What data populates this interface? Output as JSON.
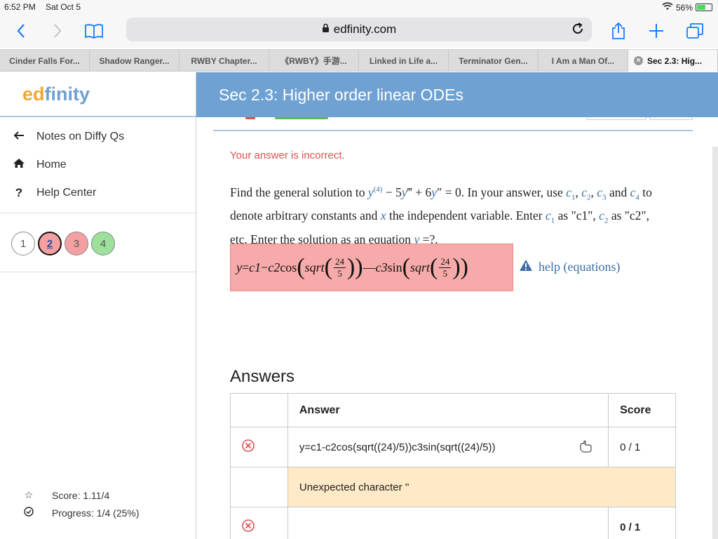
{
  "status": {
    "time": "6:52 PM",
    "day": "Sat Oct 5",
    "battery": "56%",
    "battery_level": 0.56
  },
  "browser": {
    "url": "edfinity.com",
    "tabs": [
      "Cinder Falls For...",
      "Shadow Ranger...",
      "RWBY Chapter...",
      "《RWBY》手游...",
      "Linked in Life a...",
      "Terminator Gen...",
      "I Am a Man Of...",
      "Sec 2.3: Hig..."
    ]
  },
  "sidebar": {
    "logo_part1": "ed",
    "logo_part2": "finity",
    "nav": [
      {
        "label": "Notes on Diffy Qs",
        "icon": "arrow-left-icon"
      },
      {
        "label": "Home",
        "icon": "home-icon"
      },
      {
        "label": "Help Center",
        "icon": "question-icon"
      }
    ],
    "questions": [
      "1",
      "2",
      "3",
      "4"
    ],
    "score": "Score: 1.11/4",
    "progress": "Progress: 1/4 (25%)"
  },
  "header": {
    "title": "Sec 2.3: Higher order linear ODEs"
  },
  "problem": {
    "feedback": "Your answer is incorrect.",
    "help_label": "help (equations)"
  },
  "answers": {
    "heading": "Answers",
    "columns": [
      "Answer",
      "Score"
    ],
    "rows": [
      {
        "answer": "y=c1-c2cos(sqrt((24)/5))c3sin(sqrt((24)/5))",
        "score": "0 / 1",
        "message": "Unexpected character ''"
      },
      {
        "answer": "",
        "score": "0 / 1"
      }
    ]
  },
  "colors": {
    "header": "#6fa1d2",
    "incorrect": "#d9534f",
    "answer_bg": "#f7aaaa",
    "warning_bg": "#ffe9c6"
  }
}
